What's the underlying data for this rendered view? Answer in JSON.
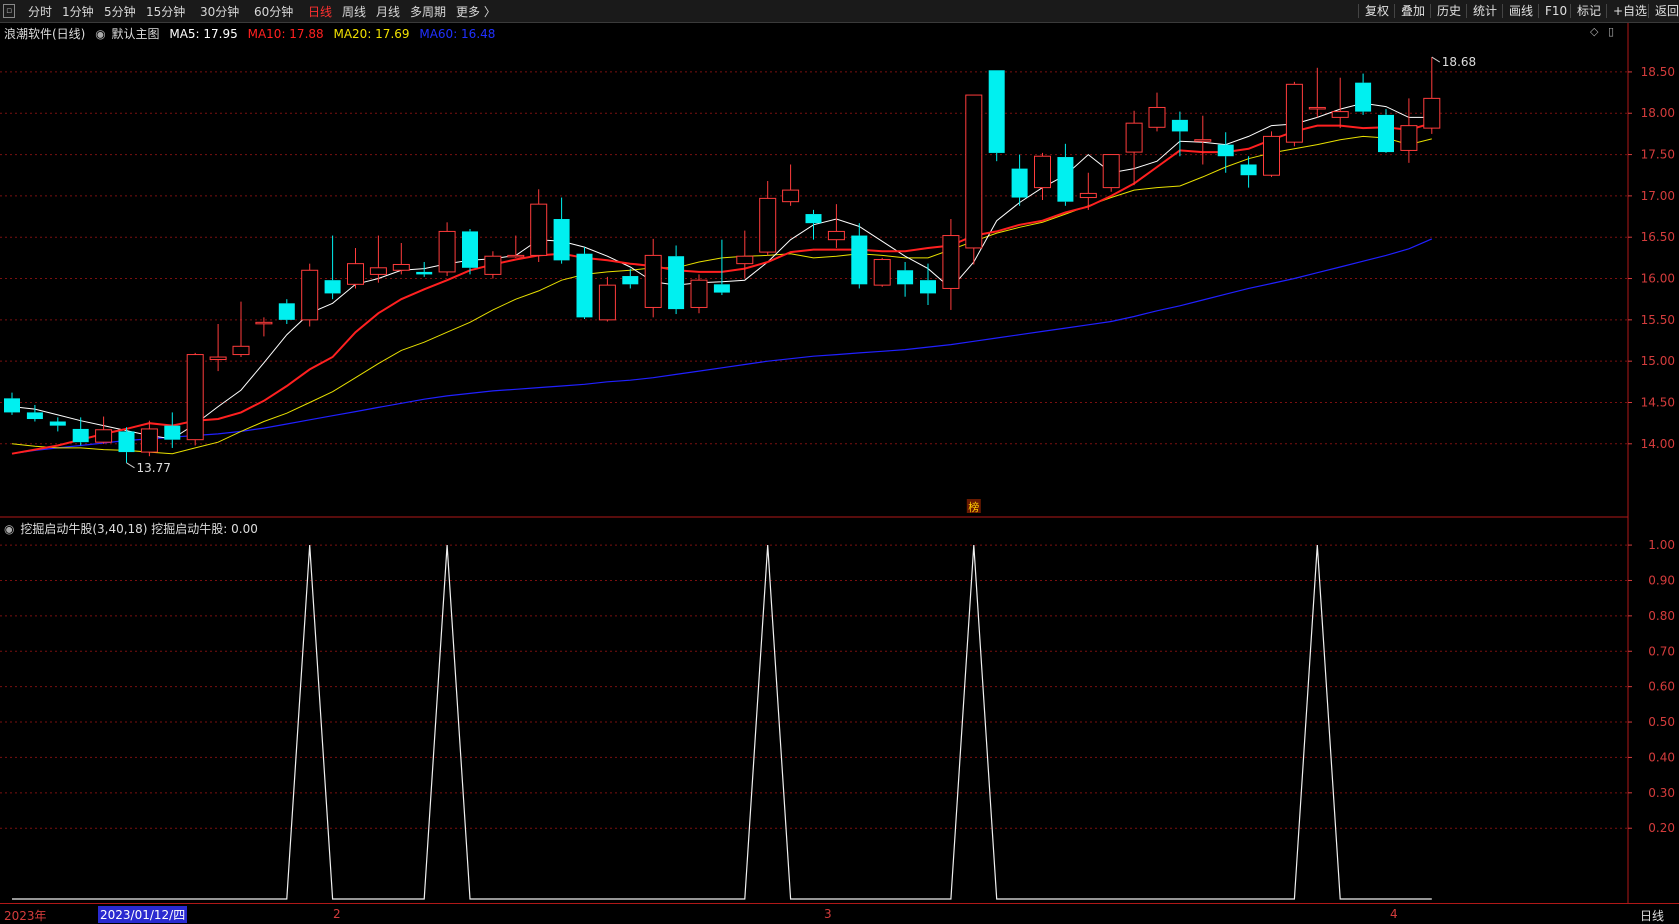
{
  "toolbar": {
    "periods": [
      "分时",
      "1分钟",
      "5分钟",
      "15分钟",
      "30分钟",
      "60分钟",
      "日线",
      "周线",
      "月线",
      "多周期",
      "更多 〉"
    ],
    "active_period": "日线",
    "right_buttons": [
      "复权",
      "叠加",
      "历史",
      "统计",
      "画线",
      "F10",
      "标记",
      "+自选",
      "返回"
    ]
  },
  "main_legend": {
    "stock_label": "浪潮软件(日线)",
    "template_label": "默认主图",
    "ma5": "MA5: 17.95",
    "ma10": "MA10: 17.88",
    "ma20": "MA20: 17.69",
    "ma60": "MA60: 16.48"
  },
  "colors": {
    "ma5": "#ffffff",
    "ma10": "#ff2020",
    "ma20": "#e8e000",
    "ma60": "#2020ff",
    "up": "#ff3c3c",
    "down": "#00f0f0",
    "axis": "#d43c3c",
    "grid": "#7a1010"
  },
  "annotations": {
    "low": "13.77",
    "high": "18.68",
    "marker": "榜"
  },
  "indicator_legend": {
    "label": "挖掘启动牛股(3,40,18)  挖掘启动牛股: 0.00"
  },
  "price_axis": [
    "18.50",
    "18.00",
    "17.50",
    "17.00",
    "16.50",
    "16.00",
    "15.50",
    "15.00",
    "14.50",
    "14.00"
  ],
  "indicator_axis": [
    "1.00",
    "0.90",
    "0.80",
    "0.70",
    "0.60",
    "0.50",
    "0.40",
    "0.30",
    "0.20"
  ],
  "bottom": {
    "year": "2023年",
    "cursor_date": "2023/01/12/四",
    "month_marks": [
      "2",
      "3",
      "4"
    ],
    "period_label": "日线"
  },
  "chart_data": {
    "type": "candlestick",
    "ylim": [
      13.55,
      18.85
    ],
    "candles": [
      [
        14.55,
        14.38,
        14.62,
        14.35
      ],
      [
        14.38,
        14.3,
        14.47,
        14.27
      ],
      [
        14.27,
        14.22,
        14.32,
        14.15
      ],
      [
        14.18,
        14.02,
        14.32,
        13.98
      ],
      [
        14.02,
        14.17,
        14.33,
        14.0
      ],
      [
        14.15,
        13.9,
        14.2,
        13.77
      ],
      [
        13.9,
        14.18,
        14.28,
        13.85
      ],
      [
        14.22,
        14.05,
        14.38,
        13.95
      ],
      [
        14.05,
        15.08,
        15.1,
        13.98
      ],
      [
        15.02,
        15.05,
        15.45,
        14.88
      ],
      [
        15.08,
        15.18,
        15.72,
        15.05
      ],
      [
        15.47,
        15.47,
        15.53,
        15.3
      ],
      [
        15.7,
        15.5,
        15.75,
        15.45
      ],
      [
        15.5,
        16.1,
        16.18,
        15.42
      ],
      [
        15.98,
        15.82,
        16.52,
        15.75
      ],
      [
        15.93,
        16.18,
        16.37,
        15.88
      ],
      [
        16.05,
        16.13,
        16.52,
        15.95
      ],
      [
        16.1,
        16.17,
        16.43,
        16.05
      ],
      [
        16.08,
        16.05,
        16.2,
        16.02
      ],
      [
        16.08,
        16.57,
        16.68,
        16.03
      ],
      [
        16.57,
        16.13,
        16.6,
        16.05
      ],
      [
        16.05,
        16.27,
        16.33,
        16.0
      ],
      [
        16.27,
        16.28,
        16.52,
        16.25
      ],
      [
        16.28,
        16.9,
        17.08,
        16.2
      ],
      [
        16.72,
        16.22,
        16.98,
        16.18
      ],
      [
        16.3,
        15.53,
        16.38,
        15.51
      ],
      [
        15.5,
        15.92,
        16.02,
        15.48
      ],
      [
        16.03,
        15.93,
        16.12,
        15.88
      ],
      [
        15.65,
        16.28,
        16.48,
        15.53
      ],
      [
        16.27,
        15.63,
        16.4,
        15.57
      ],
      [
        15.65,
        15.98,
        16.05,
        15.58
      ],
      [
        15.93,
        15.83,
        16.47,
        15.8
      ],
      [
        16.18,
        16.27,
        16.58,
        16.0
      ],
      [
        16.32,
        16.97,
        17.18,
        16.28
      ],
      [
        16.93,
        17.07,
        17.38,
        16.88
      ],
      [
        16.78,
        16.67,
        16.83,
        16.47
      ],
      [
        16.47,
        16.57,
        16.9,
        16.37
      ],
      [
        16.52,
        15.93,
        16.67,
        15.88
      ],
      [
        15.92,
        16.23,
        16.25,
        15.9
      ],
      [
        16.1,
        15.93,
        16.2,
        15.78
      ],
      [
        15.98,
        15.82,
        16.18,
        15.68
      ],
      [
        15.88,
        16.52,
        16.72,
        15.62
      ],
      [
        16.37,
        18.22,
        18.22,
        16.17
      ],
      [
        18.52,
        17.52,
        18.52,
        17.42
      ],
      [
        17.33,
        16.98,
        17.5,
        16.88
      ],
      [
        17.1,
        17.48,
        17.52,
        16.95
      ],
      [
        17.47,
        16.93,
        17.63,
        16.88
      ],
      [
        16.98,
        17.03,
        17.28,
        16.83
      ],
      [
        17.1,
        17.5,
        17.5,
        17.05
      ],
      [
        17.53,
        17.88,
        18.03,
        17.13
      ],
      [
        17.83,
        18.07,
        18.25,
        17.78
      ],
      [
        17.92,
        17.78,
        18.02,
        17.48
      ],
      [
        17.68,
        17.68,
        17.97,
        17.38
      ],
      [
        17.62,
        17.48,
        17.77,
        17.28
      ],
      [
        17.38,
        17.25,
        17.48,
        17.1
      ],
      [
        17.25,
        17.72,
        17.78,
        17.23
      ],
      [
        17.65,
        18.35,
        18.38,
        17.6
      ],
      [
        18.07,
        18.07,
        18.55,
        17.95
      ],
      [
        17.95,
        18.02,
        18.43,
        17.82
      ],
      [
        18.37,
        18.02,
        18.48,
        17.98
      ],
      [
        17.98,
        17.53,
        18.05,
        17.52
      ],
      [
        17.55,
        17.85,
        18.18,
        17.4
      ],
      [
        17.82,
        18.18,
        18.68,
        17.75
      ]
    ],
    "ma5": [
      14.45,
      14.42,
      14.35,
      14.28,
      14.22,
      14.16,
      14.1,
      14.06,
      14.24,
      14.45,
      14.65,
      14.98,
      15.32,
      15.58,
      15.7,
      15.93,
      16.0,
      16.1,
      16.12,
      16.18,
      16.22,
      16.24,
      16.28,
      16.47,
      16.45,
      16.38,
      16.27,
      16.14,
      15.96,
      15.92,
      15.95,
      15.96,
      15.98,
      16.2,
      16.47,
      16.65,
      16.72,
      16.63,
      16.45,
      16.27,
      16.12,
      15.88,
      16.2,
      16.7,
      16.92,
      17.1,
      17.25,
      17.5,
      17.28,
      17.33,
      17.42,
      17.66,
      17.65,
      17.62,
      17.72,
      17.85,
      17.87,
      17.95,
      18.05,
      18.12,
      18.08,
      17.95,
      17.95
    ],
    "ma10": [
      13.88,
      13.93,
      13.98,
      14.05,
      14.12,
      14.18,
      14.25,
      14.22,
      14.28,
      14.3,
      14.38,
      14.52,
      14.7,
      14.9,
      15.05,
      15.35,
      15.58,
      15.75,
      15.87,
      15.98,
      16.1,
      16.17,
      16.23,
      16.28,
      16.3,
      16.25,
      16.22,
      16.18,
      16.15,
      16.1,
      16.08,
      16.08,
      16.12,
      16.2,
      16.32,
      16.35,
      16.35,
      16.35,
      16.33,
      16.33,
      16.37,
      16.4,
      16.52,
      16.57,
      16.65,
      16.7,
      16.8,
      16.87,
      17.0,
      17.15,
      17.35,
      17.55,
      17.53,
      17.53,
      17.57,
      17.68,
      17.78,
      17.85,
      17.85,
      17.82,
      17.83,
      17.8,
      17.88
    ],
    "ma20": [
      14.0,
      13.97,
      13.95,
      13.95,
      13.93,
      13.92,
      13.9,
      13.88,
      13.95,
      14.02,
      14.15,
      14.27,
      14.37,
      14.5,
      14.63,
      14.8,
      14.97,
      15.13,
      15.23,
      15.35,
      15.47,
      15.62,
      15.75,
      15.85,
      15.98,
      16.05,
      16.08,
      16.1,
      16.13,
      16.13,
      16.2,
      16.25,
      16.27,
      16.28,
      16.3,
      16.25,
      16.27,
      16.3,
      16.28,
      16.25,
      16.25,
      16.35,
      16.45,
      16.55,
      16.62,
      16.68,
      16.78,
      16.88,
      16.98,
      17.07,
      17.1,
      17.12,
      17.23,
      17.35,
      17.45,
      17.52,
      17.57,
      17.62,
      17.68,
      17.72,
      17.7,
      17.62,
      17.69
    ],
    "ma60": [
      13.88,
      13.92,
      13.95,
      13.98,
      14.01,
      14.04,
      14.06,
      14.08,
      14.1,
      14.12,
      14.15,
      14.19,
      14.24,
      14.29,
      14.34,
      14.39,
      14.44,
      14.49,
      14.54,
      14.58,
      14.61,
      14.64,
      14.66,
      14.68,
      14.7,
      14.72,
      14.75,
      14.77,
      14.8,
      14.84,
      14.88,
      14.92,
      14.96,
      15.0,
      15.03,
      15.06,
      15.08,
      15.1,
      15.12,
      15.14,
      15.17,
      15.2,
      15.24,
      15.28,
      15.32,
      15.36,
      15.4,
      15.44,
      15.48,
      15.54,
      15.61,
      15.67,
      15.74,
      15.81,
      15.88,
      15.94,
      16.0,
      16.07,
      16.14,
      16.21,
      16.28,
      16.36,
      16.48
    ],
    "indicator": {
      "name": "挖掘启动牛股",
      "ylim": [
        0,
        1.02
      ],
      "values": [
        0,
        0,
        0,
        0,
        0,
        0,
        0,
        0,
        0,
        0,
        0,
        0,
        0,
        1,
        0,
        0,
        0,
        0,
        0,
        1,
        0,
        0,
        0,
        0,
        0,
        0,
        0,
        0,
        0,
        0,
        0,
        0,
        0,
        1,
        0,
        0,
        0,
        0,
        0,
        0,
        0,
        0,
        1,
        0,
        0,
        0,
        0,
        0,
        0,
        0,
        0,
        0,
        0,
        0,
        0,
        0,
        0,
        1,
        0,
        0,
        0,
        0,
        0
      ]
    }
  }
}
